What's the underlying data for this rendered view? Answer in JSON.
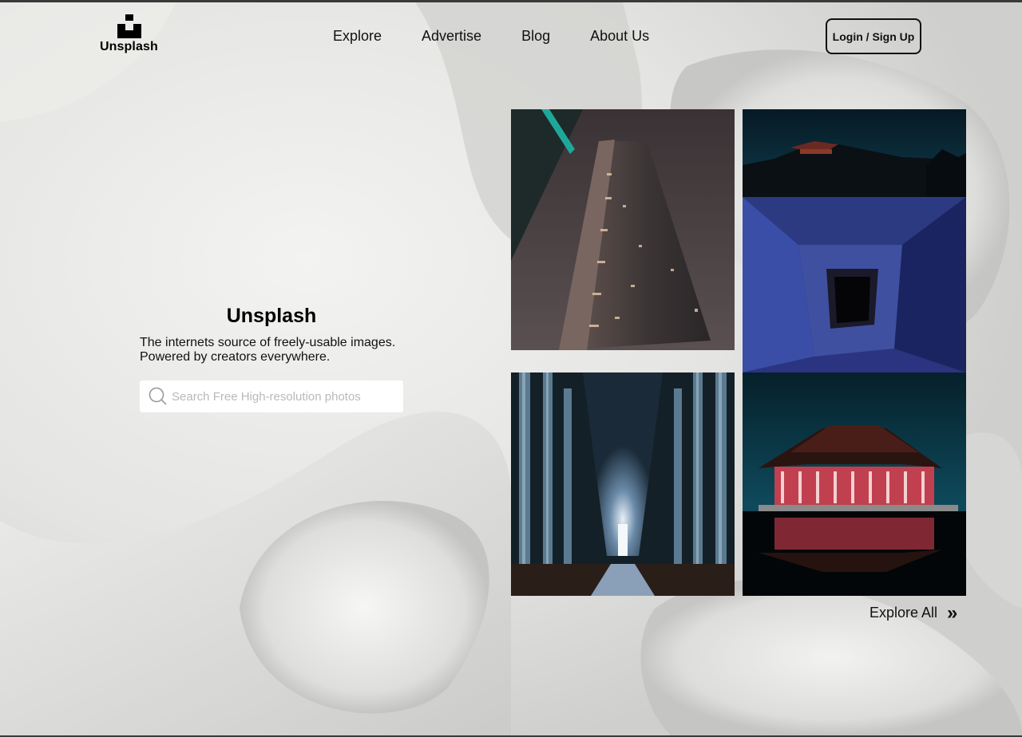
{
  "brand": {
    "name": "Unsplash"
  },
  "nav": {
    "items": [
      {
        "label": "Explore"
      },
      {
        "label": "Advertise"
      },
      {
        "label": "Blog"
      },
      {
        "label": "About Us"
      }
    ]
  },
  "header": {
    "login_label": "Login / Sign Up"
  },
  "hero": {
    "title": "Unsplash",
    "tagline_line1": "The internets source of freely-usable images.",
    "tagline_line2": "Powered by creators everywhere."
  },
  "search": {
    "placeholder": "Search Free High-resolution photos",
    "value": "",
    "icon": "search-icon"
  },
  "gallery": {
    "explore_all_label": "Explore All",
    "explore_all_icon": "»"
  },
  "colors": {
    "text": "#111111",
    "background": "#e8e8e6",
    "search_bg": "#ffffff"
  }
}
